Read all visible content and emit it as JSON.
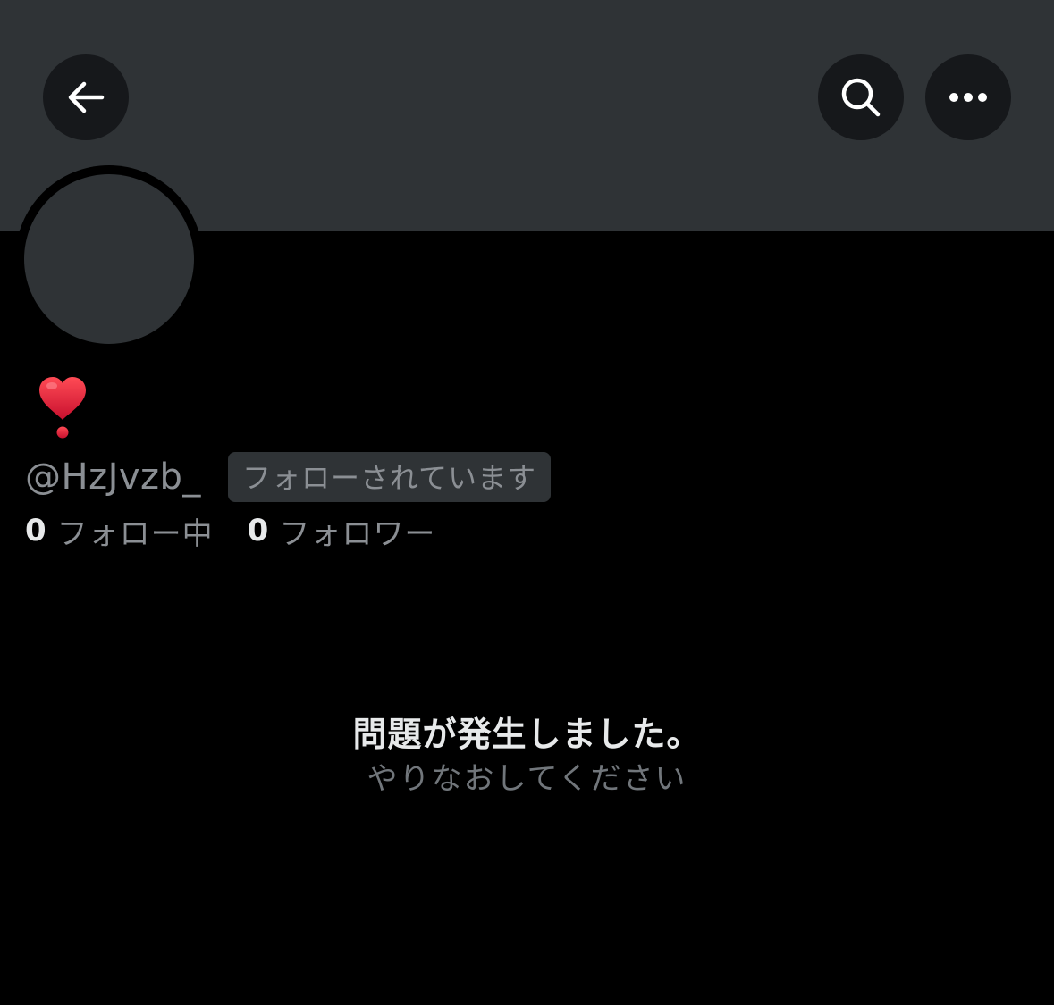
{
  "header": {
    "back_icon": "arrow-left-icon",
    "search_icon": "search-icon",
    "more_icon": "more-horizontal-icon"
  },
  "profile": {
    "display_name_icon": "red-heart-exclamation-emoji",
    "handle": "@HzJvzb_",
    "follows_you_badge": "フォローされています",
    "following_count": "0",
    "following_label": "フォロー中",
    "followers_count": "0",
    "followers_label": "フォロワー"
  },
  "error": {
    "title": "問題が発生しました。",
    "subtitle": "やりなおしてください"
  },
  "colors": {
    "background": "#000000",
    "banner": "#2f3336",
    "primary_text": "#e7e9ea",
    "secondary_text": "#8b8f94",
    "emoji_red": "#e0202d"
  }
}
